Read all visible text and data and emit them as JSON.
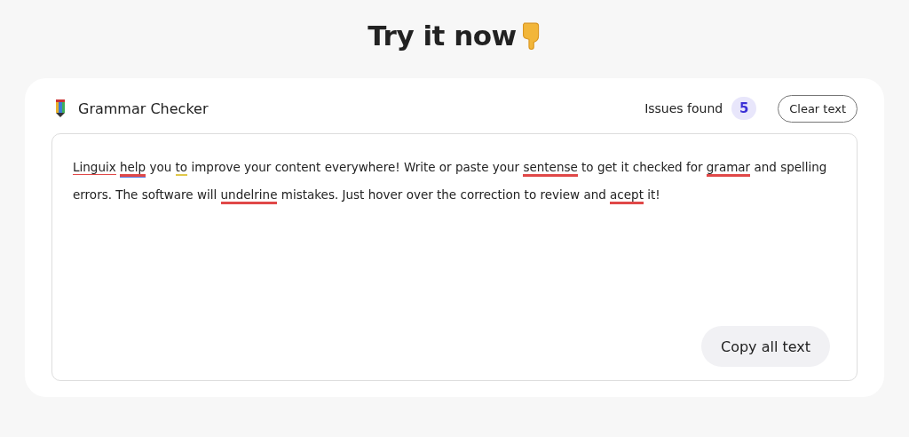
{
  "heading": {
    "title": "Try it now"
  },
  "checker": {
    "title": "Grammar Checker",
    "issues_label": "Issues found",
    "issues_count": "5",
    "clear_button": "Clear text",
    "segments": [
      {
        "text": "Linguix",
        "kind": "name",
        "space_after": true
      },
      {
        "text": "help",
        "kind": "grammar"
      },
      {
        "text": " you ",
        "kind": "plain"
      },
      {
        "text": "to",
        "kind": "style"
      },
      {
        "text": " improve your content everywhere! Write or paste your ",
        "kind": "plain"
      },
      {
        "text": "sentense",
        "kind": "spelling"
      },
      {
        "text": " to get it checked for ",
        "kind": "plain"
      },
      {
        "text": "gramar",
        "kind": "spelling"
      },
      {
        "text": " and spelling errors. The software will ",
        "kind": "plain"
      },
      {
        "text": "undelrine",
        "kind": "spelling"
      },
      {
        "text": " mistakes. Just hover over the correction to review and ",
        "kind": "plain"
      },
      {
        "text": "acept",
        "kind": "spelling"
      },
      {
        "text": " it!",
        "kind": "plain"
      }
    ],
    "copy_button": "Copy all text"
  }
}
